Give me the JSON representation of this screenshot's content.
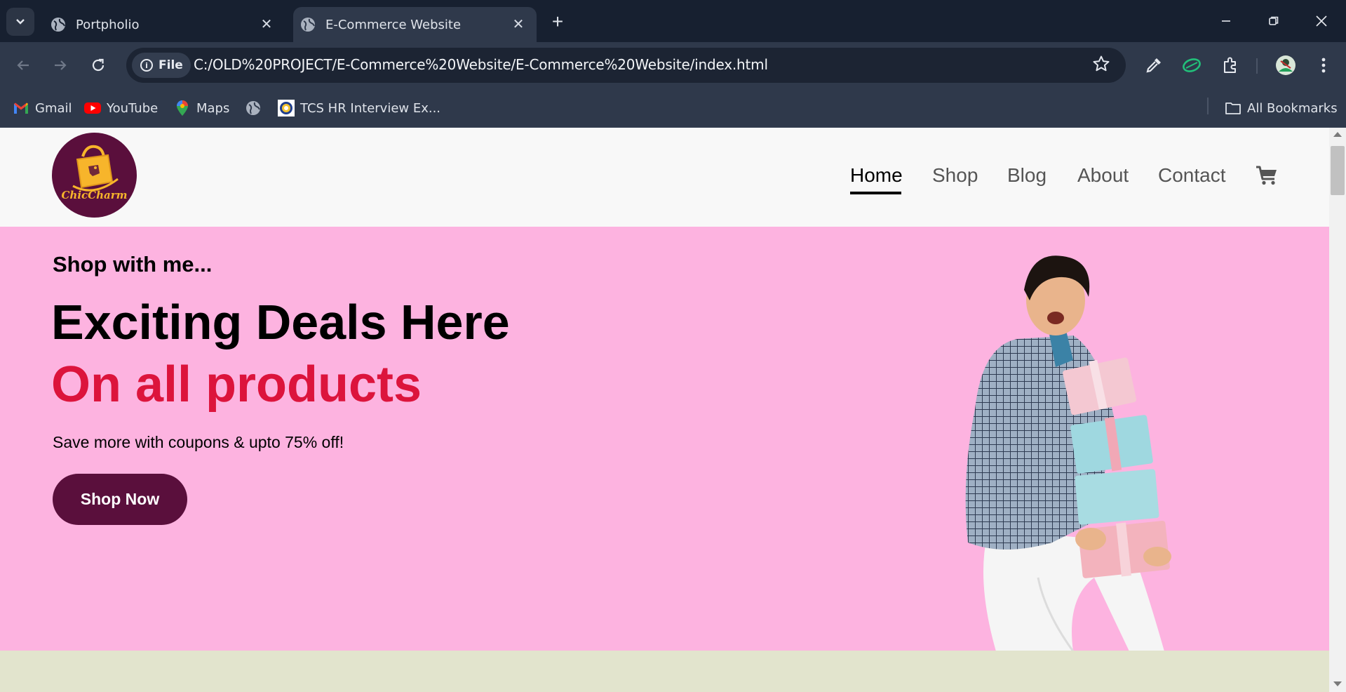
{
  "browser": {
    "tabs": [
      {
        "title": "Portpholio",
        "active": false
      },
      {
        "title": "E-Commerce Website",
        "active": true
      }
    ],
    "address": {
      "chip_label": "File",
      "url": "C:/OLD%20PROJECT/E-Commerce%20Website/E-Commerce%20Website/index.html"
    },
    "bookmarks": [
      {
        "label": "Gmail",
        "icon": "gmail-icon"
      },
      {
        "label": "YouTube",
        "icon": "youtube-icon"
      },
      {
        "label": "Maps",
        "icon": "maps-icon"
      },
      {
        "label": "",
        "icon": "globe-icon"
      },
      {
        "label": "TCS HR Interview Ex...",
        "icon": "tcs-icon"
      }
    ],
    "all_bookmarks_label": "All Bookmarks"
  },
  "site": {
    "logo_text": "ChicCharm",
    "nav": [
      {
        "label": "Home",
        "active": true
      },
      {
        "label": "Shop",
        "active": false
      },
      {
        "label": "Blog",
        "active": false
      },
      {
        "label": "About",
        "active": false
      },
      {
        "label": "Contact",
        "active": false
      }
    ],
    "hero": {
      "kicker": "Shop with me...",
      "title": "Exciting Deals Here",
      "subtitle": "On all products",
      "text": "Save more with coupons & upto 75% off!",
      "button_label": "Shop Now"
    }
  },
  "colors": {
    "brand": "#5a0f3c",
    "hero_bg": "#fdb3e0",
    "accent": "#dc143c",
    "logo_gold": "#f7b52b",
    "next_section_bg": "#e2e4cd"
  }
}
